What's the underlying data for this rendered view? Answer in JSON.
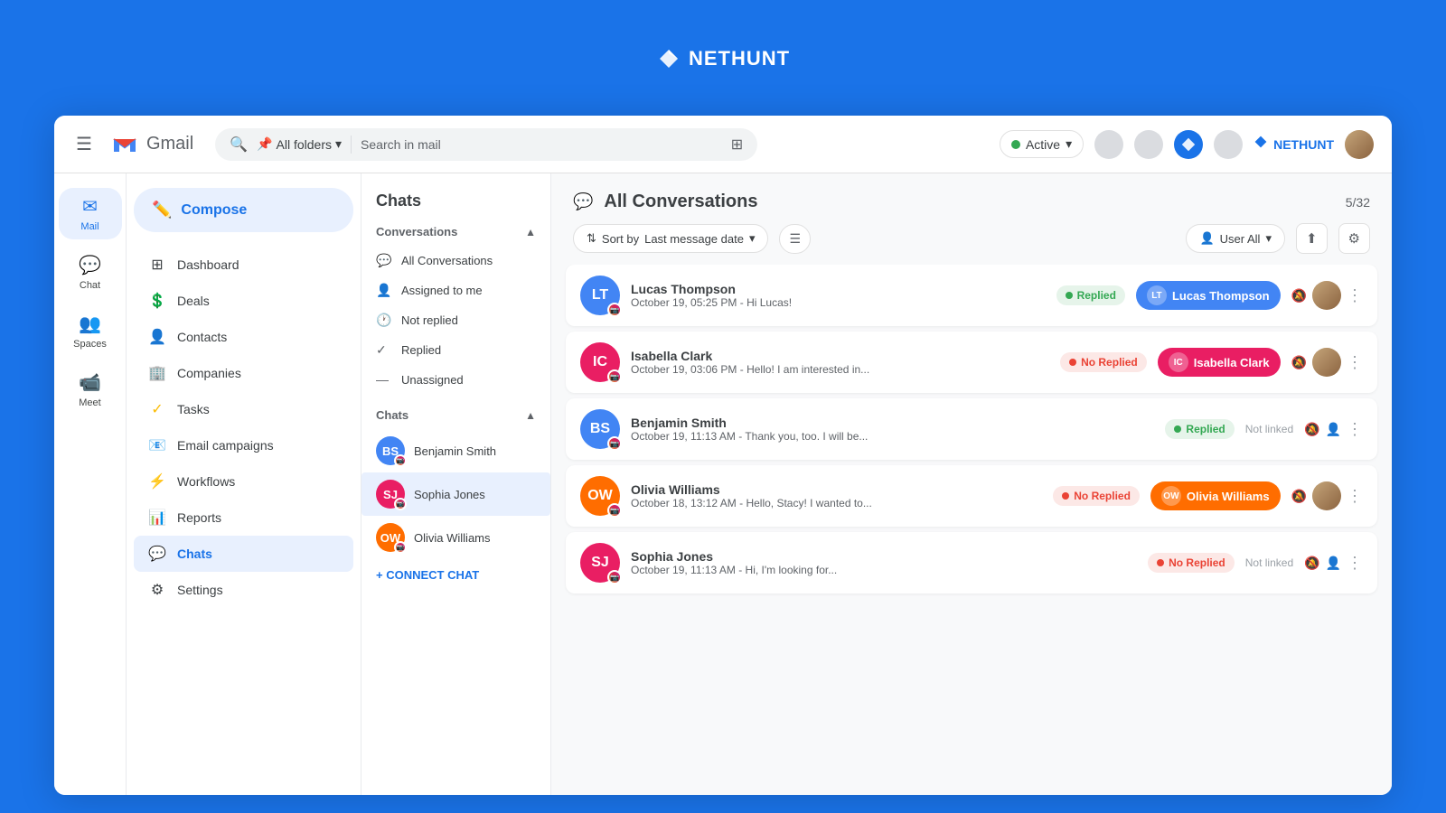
{
  "topBanner": {
    "logoText": "NETHUNT"
  },
  "topBar": {
    "hamburgerLabel": "☰",
    "gmailLabel": "Gmail",
    "searchPlaceholder": "Search in mail",
    "allFoldersLabel": "All folders",
    "activeLabel": "Active",
    "filterIcon": "⊞",
    "nethuntLabel": "NETHUNT"
  },
  "gmailNav": [
    {
      "id": "mail",
      "icon": "✉",
      "label": "Mail",
      "active": true
    },
    {
      "id": "chat",
      "icon": "💬",
      "label": "Chat",
      "active": false
    },
    {
      "id": "spaces",
      "icon": "👥",
      "label": "Spaces",
      "active": false
    },
    {
      "id": "meet",
      "icon": "📹",
      "label": "Meet",
      "active": false
    }
  ],
  "crmNav": {
    "composeLabel": "Compose",
    "items": [
      {
        "id": "dashboard",
        "icon": "⊞",
        "label": "Dashboard"
      },
      {
        "id": "deals",
        "icon": "$",
        "label": "Deals"
      },
      {
        "id": "contacts",
        "icon": "👤",
        "label": "Contacts"
      },
      {
        "id": "companies",
        "icon": "🏢",
        "label": "Companies"
      },
      {
        "id": "tasks",
        "icon": "✓",
        "label": "Tasks"
      },
      {
        "id": "email-campaigns",
        "icon": "📧",
        "label": "Email campaigns"
      },
      {
        "id": "workflows",
        "icon": "⚡",
        "label": "Workflows"
      },
      {
        "id": "reports",
        "icon": "📊",
        "label": "Reports"
      },
      {
        "id": "chats",
        "icon": "💬",
        "label": "Chats",
        "active": true
      },
      {
        "id": "settings",
        "icon": "⚙",
        "label": "Settings"
      }
    ]
  },
  "chatsPanel": {
    "title": "Chats",
    "conversationsLabel": "Conversations",
    "convItems": [
      {
        "id": "all",
        "icon": "💬",
        "label": "All Conversations"
      },
      {
        "id": "assigned",
        "icon": "👤",
        "label": "Assigned to me"
      },
      {
        "id": "not-replied",
        "icon": "🕐",
        "label": "Not replied"
      },
      {
        "id": "replied",
        "icon": "✓",
        "label": "Replied"
      },
      {
        "id": "unassigned",
        "icon": "—",
        "label": "Unassigned"
      }
    ],
    "chatsLabel": "Chats",
    "chatContacts": [
      {
        "id": "benjamin-smith",
        "name": "Benjamin Smith",
        "initials": "BS",
        "color": "#4285f4"
      },
      {
        "id": "sophia-jones",
        "name": "Sophia Jones",
        "initials": "SJ",
        "color": "#e91e63",
        "active": true
      },
      {
        "id": "olivia-williams",
        "name": "Olivia Williams",
        "initials": "OW",
        "color": "#ff6d00"
      }
    ],
    "connectChatLabel": "+ CONNECT CHAT"
  },
  "conversationsMain": {
    "title": "All Conversations",
    "count": "5/32",
    "sortLabel": "Sort by",
    "sortValue": "Last message date",
    "userAllLabel": "User All",
    "conversations": [
      {
        "id": "lucas-thompson",
        "name": "Lucas Thompson",
        "date": "October 19, 05:25 PM",
        "preview": "Hi Lucas!",
        "statusType": "replied",
        "statusLabel": "Replied",
        "linkedName": "Lucas Thompson",
        "linkedColor": "#4285f4",
        "linkedInitials": "LT",
        "isLinked": true
      },
      {
        "id": "isabella-clark",
        "name": "Isabella Clark",
        "date": "October 19, 03:06 PM",
        "preview": "Hello! I am interested in...",
        "statusType": "no-replied",
        "statusLabel": "No Replied",
        "linkedName": "Isabella Clark",
        "linkedColor": "#e91e63",
        "linkedInitials": "IC",
        "isLinked": true
      },
      {
        "id": "benjamin-smith",
        "name": "Benjamin Smith",
        "date": "October 19, 11:13 AM",
        "preview": "Thank you, too. I will be...",
        "statusType": "replied",
        "statusLabel": "Replied",
        "linkedName": "",
        "isLinked": false,
        "notLinkedLabel": "Not linked"
      },
      {
        "id": "olivia-williams",
        "name": "Olivia Williams",
        "date": "October 18, 13:12 AM",
        "preview": "Hello, Stacy! I wanted to...",
        "statusType": "no-replied",
        "statusLabel": "No Replied",
        "linkedName": "Olivia Williams",
        "linkedColor": "#ff6d00",
        "linkedInitials": "OW",
        "isLinked": true
      },
      {
        "id": "sophia-jones",
        "name": "Sophia Jones",
        "date": "October 19, 11:13 AM",
        "preview": "Hi, I'm looking for...",
        "statusType": "no-replied",
        "statusLabel": "No Replied",
        "linkedName": "",
        "isLinked": false,
        "notLinkedLabel": "Not linked"
      }
    ]
  }
}
